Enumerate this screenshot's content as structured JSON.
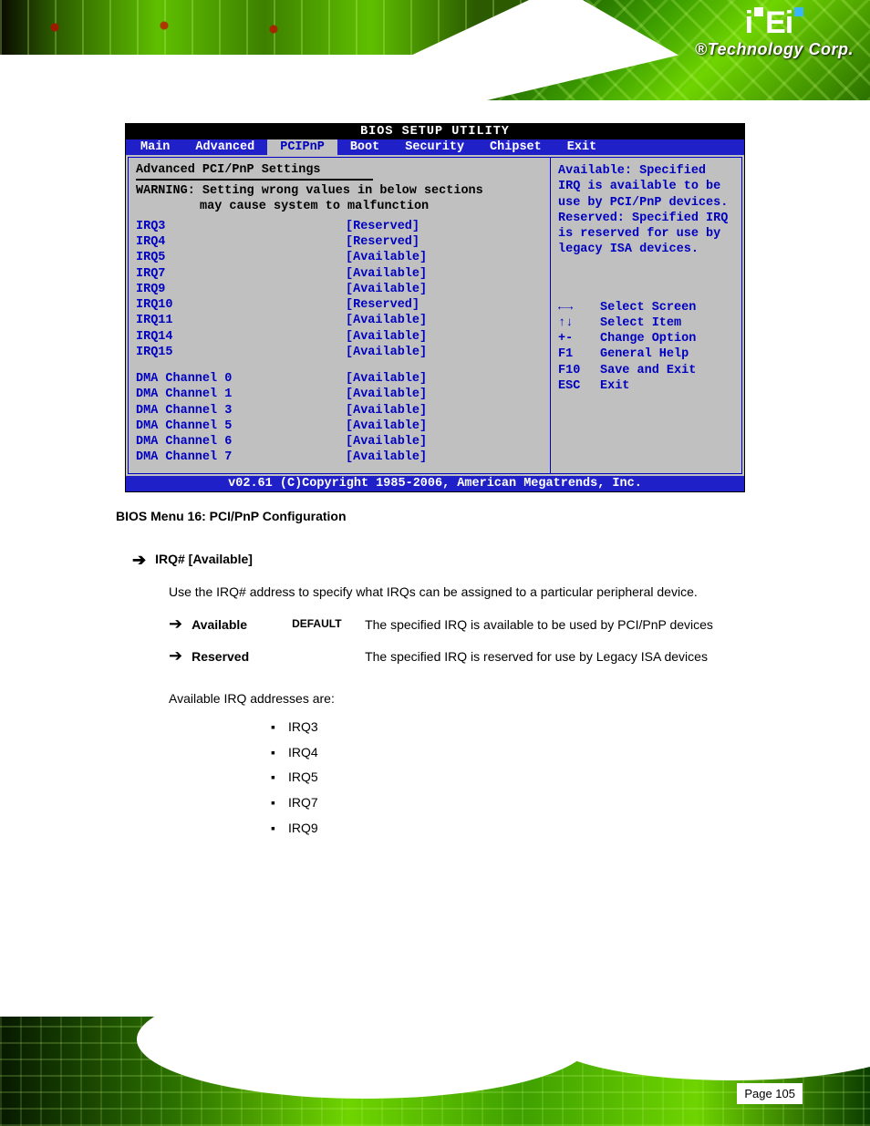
{
  "brand": {
    "tagline": "®Technology Corp."
  },
  "bios": {
    "title": "BIOS SETUP UTILITY",
    "tabs": [
      "Main",
      "Advanced",
      "PCIPnP",
      "Boot",
      "Security",
      "Chipset",
      "Exit"
    ],
    "active_tab": "PCIPnP",
    "left": {
      "header": "Advanced PCI/PnP Settings",
      "warning_l1": "WARNING: Setting wrong values in below sections",
      "warning_l2": "may cause system to malfunction",
      "rows": [
        {
          "label": "IRQ3",
          "value": "[Reserved]"
        },
        {
          "label": "IRQ4",
          "value": "[Reserved]"
        },
        {
          "label": "IRQ5",
          "value": "[Available]"
        },
        {
          "label": "IRQ7",
          "value": "[Available]"
        },
        {
          "label": "IRQ9",
          "value": "[Available]"
        },
        {
          "label": "IRQ10",
          "value": "[Reserved]"
        },
        {
          "label": "IRQ11",
          "value": "[Available]"
        },
        {
          "label": "IRQ14",
          "value": "[Available]"
        },
        {
          "label": "IRQ15",
          "value": "[Available]"
        }
      ],
      "rows2": [
        {
          "label": "DMA Channel 0",
          "value": "[Available]"
        },
        {
          "label": "DMA Channel 1",
          "value": "[Available]"
        },
        {
          "label": "DMA Channel 3",
          "value": "[Available]"
        },
        {
          "label": "DMA Channel 5",
          "value": "[Available]"
        },
        {
          "label": "DMA Channel 6",
          "value": "[Available]"
        },
        {
          "label": "DMA Channel 7",
          "value": "[Available]"
        }
      ]
    },
    "right": {
      "help_text": "Available: Specified IRQ is available to be use by PCI/PnP devices.\nReserved: Specified IRQ is reserved for use by legacy ISA devices.",
      "keys": [
        {
          "k": "←→",
          "d": "Select Screen"
        },
        {
          "k": "↑↓",
          "d": "Select Item"
        },
        {
          "k": "+-",
          "d": "Change Option"
        },
        {
          "k": "F1",
          "d": "General Help"
        },
        {
          "k": "F10",
          "d": "Save and Exit"
        },
        {
          "k": "ESC",
          "d": "Exit"
        }
      ]
    },
    "footer": "v02.61 (C)Copyright 1985-2006, American Megatrends, Inc."
  },
  "doc": {
    "caption": "BIOS Menu 16: PCI/PnP Configuration",
    "sec1_title": "IRQ# [Available]",
    "sec1_body": "Use the IRQ# address to specify what IRQs can be assigned to a particular peripheral device.",
    "opt_available": {
      "label": "Available",
      "def": "DEFAULT",
      "desc": "The specified IRQ is available to be used by PCI/PnP devices"
    },
    "opt_reserved": {
      "label": "Reserved",
      "desc": "The specified IRQ is reserved for use by Legacy ISA devices"
    },
    "irq_intro": "Available IRQ addresses are:",
    "irq_list": [
      "IRQ3",
      "IRQ4",
      "IRQ5",
      "IRQ7",
      "IRQ9"
    ],
    "page_label": "Page 105"
  }
}
